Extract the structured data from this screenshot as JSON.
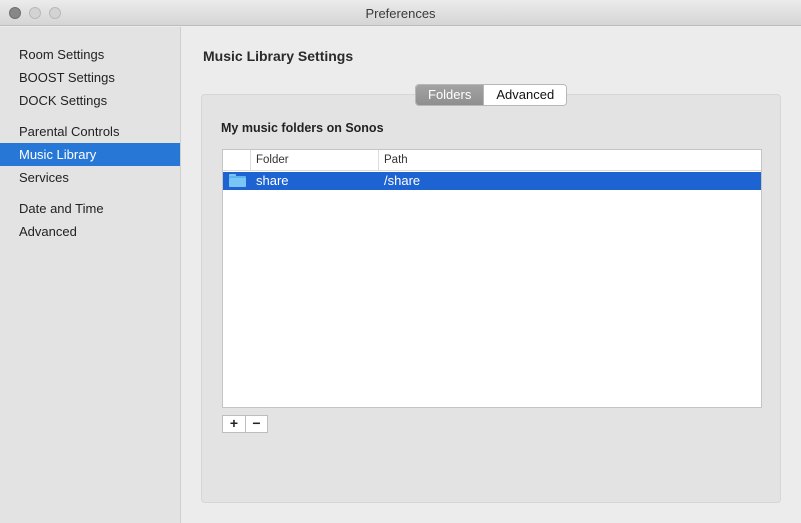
{
  "window": {
    "title": "Preferences"
  },
  "sidebar": {
    "items": [
      {
        "label": "Room Settings",
        "selected": false
      },
      {
        "label": "BOOST Settings",
        "selected": false
      },
      {
        "label": "DOCK Settings",
        "selected": false
      },
      {
        "label": "Parental Controls",
        "selected": false
      },
      {
        "label": "Music Library",
        "selected": true
      },
      {
        "label": "Services",
        "selected": false
      },
      {
        "label": "Date and Time",
        "selected": false
      },
      {
        "label": "Advanced",
        "selected": false
      }
    ]
  },
  "main": {
    "title": "Music Library Settings",
    "tabs": [
      {
        "label": "Folders",
        "active": true
      },
      {
        "label": "Advanced",
        "active": false
      }
    ],
    "section_label": "My music folders on Sonos",
    "table": {
      "columns": [
        "Folder",
        "Path"
      ],
      "rows": [
        {
          "icon": "folder-icon",
          "folder": "share",
          "path": "/share",
          "selected": true
        }
      ]
    },
    "buttons": {
      "add": "+",
      "remove": "−"
    }
  },
  "colors": {
    "selection": "#1d63d2",
    "sidebar_selection": "#2778d6"
  }
}
